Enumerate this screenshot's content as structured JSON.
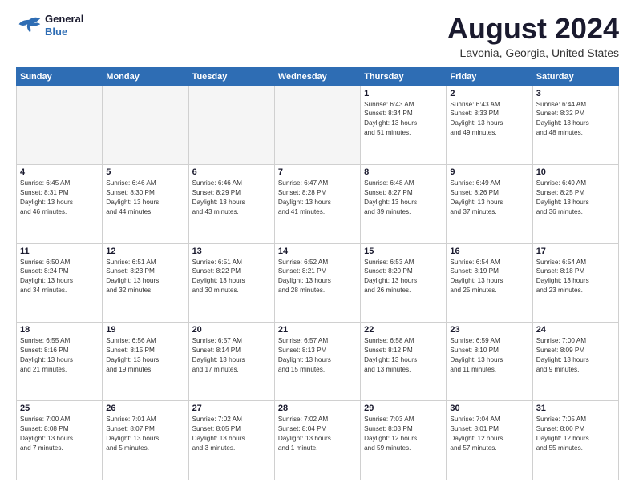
{
  "header": {
    "logo_line1": "General",
    "logo_line2": "Blue",
    "title": "August 2024",
    "subtitle": "Lavonia, Georgia, United States"
  },
  "weekdays": [
    "Sunday",
    "Monday",
    "Tuesday",
    "Wednesday",
    "Thursday",
    "Friday",
    "Saturday"
  ],
  "weeks": [
    [
      {
        "day": "",
        "info": ""
      },
      {
        "day": "",
        "info": ""
      },
      {
        "day": "",
        "info": ""
      },
      {
        "day": "",
        "info": ""
      },
      {
        "day": "1",
        "info": "Sunrise: 6:43 AM\nSunset: 8:34 PM\nDaylight: 13 hours\nand 51 minutes."
      },
      {
        "day": "2",
        "info": "Sunrise: 6:43 AM\nSunset: 8:33 PM\nDaylight: 13 hours\nand 49 minutes."
      },
      {
        "day": "3",
        "info": "Sunrise: 6:44 AM\nSunset: 8:32 PM\nDaylight: 13 hours\nand 48 minutes."
      }
    ],
    [
      {
        "day": "4",
        "info": "Sunrise: 6:45 AM\nSunset: 8:31 PM\nDaylight: 13 hours\nand 46 minutes."
      },
      {
        "day": "5",
        "info": "Sunrise: 6:46 AM\nSunset: 8:30 PM\nDaylight: 13 hours\nand 44 minutes."
      },
      {
        "day": "6",
        "info": "Sunrise: 6:46 AM\nSunset: 8:29 PM\nDaylight: 13 hours\nand 43 minutes."
      },
      {
        "day": "7",
        "info": "Sunrise: 6:47 AM\nSunset: 8:28 PM\nDaylight: 13 hours\nand 41 minutes."
      },
      {
        "day": "8",
        "info": "Sunrise: 6:48 AM\nSunset: 8:27 PM\nDaylight: 13 hours\nand 39 minutes."
      },
      {
        "day": "9",
        "info": "Sunrise: 6:49 AM\nSunset: 8:26 PM\nDaylight: 13 hours\nand 37 minutes."
      },
      {
        "day": "10",
        "info": "Sunrise: 6:49 AM\nSunset: 8:25 PM\nDaylight: 13 hours\nand 36 minutes."
      }
    ],
    [
      {
        "day": "11",
        "info": "Sunrise: 6:50 AM\nSunset: 8:24 PM\nDaylight: 13 hours\nand 34 minutes."
      },
      {
        "day": "12",
        "info": "Sunrise: 6:51 AM\nSunset: 8:23 PM\nDaylight: 13 hours\nand 32 minutes."
      },
      {
        "day": "13",
        "info": "Sunrise: 6:51 AM\nSunset: 8:22 PM\nDaylight: 13 hours\nand 30 minutes."
      },
      {
        "day": "14",
        "info": "Sunrise: 6:52 AM\nSunset: 8:21 PM\nDaylight: 13 hours\nand 28 minutes."
      },
      {
        "day": "15",
        "info": "Sunrise: 6:53 AM\nSunset: 8:20 PM\nDaylight: 13 hours\nand 26 minutes."
      },
      {
        "day": "16",
        "info": "Sunrise: 6:54 AM\nSunset: 8:19 PM\nDaylight: 13 hours\nand 25 minutes."
      },
      {
        "day": "17",
        "info": "Sunrise: 6:54 AM\nSunset: 8:18 PM\nDaylight: 13 hours\nand 23 minutes."
      }
    ],
    [
      {
        "day": "18",
        "info": "Sunrise: 6:55 AM\nSunset: 8:16 PM\nDaylight: 13 hours\nand 21 minutes."
      },
      {
        "day": "19",
        "info": "Sunrise: 6:56 AM\nSunset: 8:15 PM\nDaylight: 13 hours\nand 19 minutes."
      },
      {
        "day": "20",
        "info": "Sunrise: 6:57 AM\nSunset: 8:14 PM\nDaylight: 13 hours\nand 17 minutes."
      },
      {
        "day": "21",
        "info": "Sunrise: 6:57 AM\nSunset: 8:13 PM\nDaylight: 13 hours\nand 15 minutes."
      },
      {
        "day": "22",
        "info": "Sunrise: 6:58 AM\nSunset: 8:12 PM\nDaylight: 13 hours\nand 13 minutes."
      },
      {
        "day": "23",
        "info": "Sunrise: 6:59 AM\nSunset: 8:10 PM\nDaylight: 13 hours\nand 11 minutes."
      },
      {
        "day": "24",
        "info": "Sunrise: 7:00 AM\nSunset: 8:09 PM\nDaylight: 13 hours\nand 9 minutes."
      }
    ],
    [
      {
        "day": "25",
        "info": "Sunrise: 7:00 AM\nSunset: 8:08 PM\nDaylight: 13 hours\nand 7 minutes."
      },
      {
        "day": "26",
        "info": "Sunrise: 7:01 AM\nSunset: 8:07 PM\nDaylight: 13 hours\nand 5 minutes."
      },
      {
        "day": "27",
        "info": "Sunrise: 7:02 AM\nSunset: 8:05 PM\nDaylight: 13 hours\nand 3 minutes."
      },
      {
        "day": "28",
        "info": "Sunrise: 7:02 AM\nSunset: 8:04 PM\nDaylight: 13 hours\nand 1 minute."
      },
      {
        "day": "29",
        "info": "Sunrise: 7:03 AM\nSunset: 8:03 PM\nDaylight: 12 hours\nand 59 minutes."
      },
      {
        "day": "30",
        "info": "Sunrise: 7:04 AM\nSunset: 8:01 PM\nDaylight: 12 hours\nand 57 minutes."
      },
      {
        "day": "31",
        "info": "Sunrise: 7:05 AM\nSunset: 8:00 PM\nDaylight: 12 hours\nand 55 minutes."
      }
    ]
  ]
}
